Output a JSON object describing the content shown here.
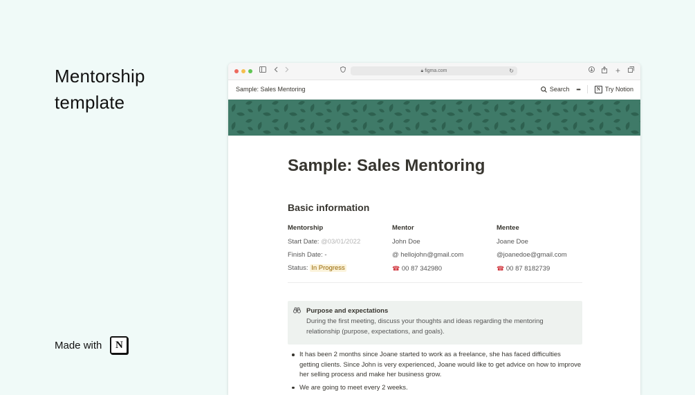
{
  "promo": {
    "title_line1": "Mentorship",
    "title_line2": "template",
    "made_with": "Made with",
    "logo_letter": "N"
  },
  "browser": {
    "url": "figma.com",
    "traffic_lights": [
      "#ed6a5e",
      "#f5bf4f",
      "#61c554"
    ]
  },
  "topbar": {
    "page_crumb": "Sample: Sales Mentoring",
    "search_label": "Search",
    "more_label": "•••",
    "try_label": "Try Notion"
  },
  "page": {
    "title": "Sample: Sales Mentoring",
    "section_title": "Basic information",
    "cover_color": "#3f7a68",
    "mentorship": {
      "heading": "Mentorship",
      "start_label": "Start Date:",
      "start_value": "@03/01/2022",
      "finish_label": "Finish Date: -",
      "status_label": "Status:",
      "status_value": "In Progress"
    },
    "mentor": {
      "heading": "Mentor",
      "name": "John Doe",
      "email": "@ hellojohn@gmail.com",
      "phone": "00 87 342980"
    },
    "mentee": {
      "heading": "Mentee",
      "name": "Joane Doe",
      "email": "@joanedoe@gmail.com",
      "phone": "00 87 8182739"
    },
    "callout": {
      "icon": "binoculars-icon",
      "title": "Purpose and expectations",
      "body": "During the first meeting, discuss your thoughts and ideas regarding the mentoring relationship (purpose, expectations, and goals)."
    },
    "bullets": [
      "It has been 2 months since Joane started to work as a freelance, she has faced difficulties getting clients. Since John is very experienced, Joane would like to get advice on how to improve her selling process and make her business grow.",
      "We are going to meet every 2 weeks."
    ]
  }
}
